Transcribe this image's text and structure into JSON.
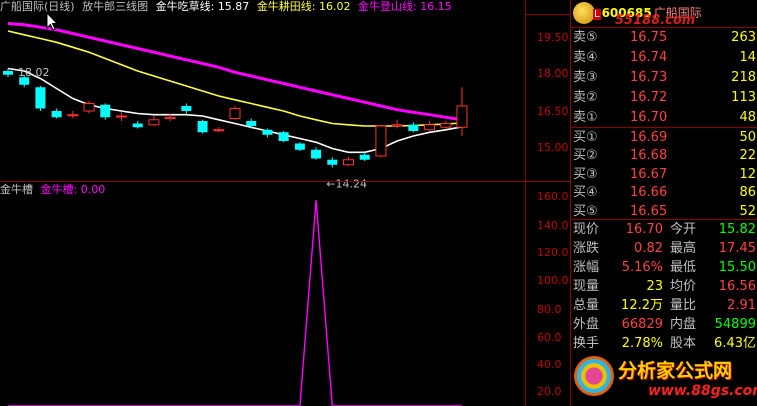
{
  "title_bar": {
    "stock_name": "广船国际(日线)",
    "indicator_name": "放牛郎三线图",
    "line1_label": "金牛吃草线:",
    "line1_value": "15.87",
    "line2_label": "金牛耕田线:",
    "line2_value": "16.02",
    "line3_label": "金牛登山线:",
    "line3_value": "16.15"
  },
  "sub_title": {
    "indicator_label": "金牛槽",
    "series_label": "金牛槽:",
    "series_value": "0.00"
  },
  "colors": {
    "line1": "#ffffff",
    "line2": "#ffff40",
    "line3": "#ff00ff",
    "up": "#ff3030",
    "down": "#00ffff",
    "axis": "#c00000"
  },
  "price_axis": [
    "19.50",
    "18.00",
    "16.50",
    "15.00"
  ],
  "indicator_axis": [
    "160.0",
    "140.0",
    "120.0",
    "100.0",
    "80.0",
    "60.0",
    "40.0",
    "20.0"
  ],
  "chart_annotations": {
    "high_mark": "18.02",
    "low_mark": "←14.24"
  },
  "chart_data": {
    "type": "candlestick",
    "price_range": [
      13.9,
      20.3
    ],
    "indicator_range": [
      0,
      170
    ],
    "candles": [
      {
        "o": 18.1,
        "c": 17.95,
        "h": 18.2,
        "l": 17.85
      },
      {
        "o": 17.85,
        "c": 17.55,
        "h": 17.95,
        "l": 17.45
      },
      {
        "o": 17.45,
        "c": 16.6,
        "h": 17.5,
        "l": 16.5
      },
      {
        "o": 16.5,
        "c": 16.25,
        "h": 16.6,
        "l": 16.2
      },
      {
        "o": 16.35,
        "c": 16.35,
        "h": 16.5,
        "l": 16.2
      },
      {
        "o": 16.5,
        "c": 16.8,
        "h": 16.9,
        "l": 16.4
      },
      {
        "o": 16.75,
        "c": 16.25,
        "h": 16.8,
        "l": 16.15
      },
      {
        "o": 16.3,
        "c": 16.3,
        "h": 16.45,
        "l": 16.1
      },
      {
        "o": 16.0,
        "c": 15.85,
        "h": 16.1,
        "l": 15.8
      },
      {
        "o": 15.95,
        "c": 16.15,
        "h": 16.3,
        "l": 15.9
      },
      {
        "o": 16.2,
        "c": 16.25,
        "h": 16.4,
        "l": 16.1
      },
      {
        "o": 16.7,
        "c": 16.5,
        "h": 16.8,
        "l": 16.4
      },
      {
        "o": 16.1,
        "c": 15.65,
        "h": 16.15,
        "l": 15.6
      },
      {
        "o": 15.75,
        "c": 15.75,
        "h": 15.85,
        "l": 15.65
      },
      {
        "o": 16.2,
        "c": 16.6,
        "h": 16.7,
        "l": 16.15
      },
      {
        "o": 16.1,
        "c": 15.9,
        "h": 16.2,
        "l": 15.8
      },
      {
        "o": 15.75,
        "c": 15.55,
        "h": 15.8,
        "l": 15.45
      },
      {
        "o": 15.65,
        "c": 15.3,
        "h": 15.7,
        "l": 15.25
      },
      {
        "o": 15.2,
        "c": 14.95,
        "h": 15.25,
        "l": 14.9
      },
      {
        "o": 14.95,
        "c": 14.6,
        "h": 15.05,
        "l": 14.55
      },
      {
        "o": 14.55,
        "c": 14.35,
        "h": 14.65,
        "l": 14.24
      },
      {
        "o": 14.35,
        "c": 14.55,
        "h": 14.65,
        "l": 14.3
      },
      {
        "o": 14.75,
        "c": 14.55,
        "h": 14.85,
        "l": 14.5
      },
      {
        "o": 14.7,
        "c": 15.9,
        "h": 15.95,
        "l": 14.65
      },
      {
        "o": 15.9,
        "c": 15.95,
        "h": 16.15,
        "l": 15.8
      },
      {
        "o": 15.95,
        "c": 15.7,
        "h": 16.05,
        "l": 15.65
      },
      {
        "o": 15.75,
        "c": 15.95,
        "h": 16.1,
        "l": 15.7
      },
      {
        "o": 15.85,
        "c": 16.0,
        "h": 16.1,
        "l": 15.8
      },
      {
        "o": 15.85,
        "c": 16.7,
        "h": 17.45,
        "l": 15.5
      }
    ],
    "series": [
      {
        "name": "金牛吃草线",
        "values": [
          18.2,
          18.1,
          17.8,
          17.4,
          17.0,
          16.75,
          16.6,
          16.5,
          16.4,
          16.35,
          16.35,
          16.35,
          16.3,
          16.15,
          16.0,
          15.85,
          15.7,
          15.55,
          15.4,
          15.25,
          15.0,
          14.85,
          14.85,
          15.0,
          15.3,
          15.5,
          15.65,
          15.75,
          15.87
        ]
      },
      {
        "name": "金牛耕田线",
        "values": [
          19.7,
          19.55,
          19.4,
          19.25,
          19.05,
          18.85,
          18.6,
          18.35,
          18.1,
          17.9,
          17.7,
          17.5,
          17.3,
          17.1,
          16.95,
          16.8,
          16.65,
          16.5,
          16.3,
          16.15,
          16.0,
          15.95,
          15.9,
          15.9,
          15.9,
          15.92,
          15.95,
          15.98,
          16.02
        ]
      },
      {
        "name": "金牛登山线",
        "values": [
          20.0,
          19.95,
          19.85,
          19.75,
          19.6,
          19.45,
          19.3,
          19.15,
          19.0,
          18.85,
          18.7,
          18.55,
          18.4,
          18.25,
          18.05,
          17.9,
          17.75,
          17.6,
          17.45,
          17.3,
          17.15,
          17.0,
          16.85,
          16.7,
          16.55,
          16.45,
          16.35,
          16.25,
          16.15
        ]
      }
    ],
    "indicator": {
      "name": "金牛槽",
      "values": [
        0,
        0,
        0,
        0,
        0,
        0,
        0,
        0,
        0,
        0,
        0,
        0,
        0,
        0,
        0,
        0,
        0,
        0,
        0,
        165,
        0,
        0,
        0,
        0,
        0,
        0,
        0,
        0,
        0
      ]
    }
  },
  "quote": {
    "stock_code": "600685",
    "stock_name": "广船国际",
    "badge": "L",
    "top_watermark": "55188.com",
    "sell": [
      {
        "label": "卖⑤",
        "price": "16.75",
        "vol": "263"
      },
      {
        "label": "卖④",
        "price": "16.74",
        "vol": "14"
      },
      {
        "label": "卖③",
        "price": "16.73",
        "vol": "218"
      },
      {
        "label": "卖②",
        "price": "16.72",
        "vol": "113"
      },
      {
        "label": "卖①",
        "price": "16.70",
        "vol": "48"
      }
    ],
    "buy": [
      {
        "label": "买①",
        "price": "16.69",
        "vol": "50"
      },
      {
        "label": "买②",
        "price": "16.68",
        "vol": "22"
      },
      {
        "label": "买③",
        "price": "16.67",
        "vol": "12"
      },
      {
        "label": "买④",
        "price": "16.66",
        "vol": "86"
      },
      {
        "label": "买⑤",
        "price": "16.65",
        "vol": "52"
      }
    ],
    "stats": [
      {
        "l1": "现价",
        "v1": "16.70",
        "c1": "#ff4040",
        "l2": "今开",
        "v2": "15.82",
        "c2": "#00ff00"
      },
      {
        "l1": "涨跌",
        "v1": "0.82",
        "c1": "#ff4040",
        "l2": "最高",
        "v2": "17.45",
        "c2": "#ff4040"
      },
      {
        "l1": "涨幅",
        "v1": "5.16%",
        "c1": "#ff4040",
        "l2": "最低",
        "v2": "15.50",
        "c2": "#00ff00"
      },
      {
        "l1": "现量",
        "v1": "23",
        "c1": "#ffff00",
        "l2": "均价",
        "v2": "16.56",
        "c2": "#ff4040"
      },
      {
        "l1": "总量",
        "v1": "12.2万",
        "c1": "#ffff00",
        "l2": "量比",
        "v2": "2.91",
        "c2": "#ff4040"
      },
      {
        "l1": "外盘",
        "v1": "66829",
        "c1": "#ff4040",
        "l2": "内盘",
        "v2": "54899",
        "c2": "#00ff00"
      },
      {
        "l1": "换手",
        "v1": "2.78%",
        "c1": "#ffff00",
        "l2": "股本",
        "v2": "6.43亿",
        "c2": "#ffff00"
      }
    ]
  },
  "watermark": {
    "title": "分析家公式网",
    "url": "www.88gs.com"
  }
}
